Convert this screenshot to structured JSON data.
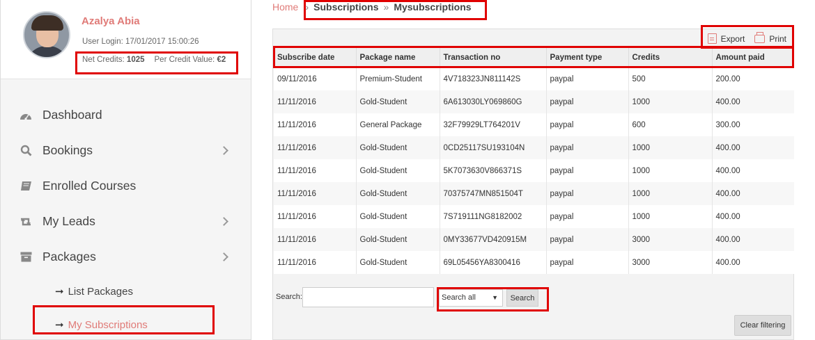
{
  "profile": {
    "name": "Azalya Abia",
    "login_label": "User Login: 17/01/2017 15:00:26",
    "net_credits_label": "Net Credits: ",
    "net_credits_value": "1025",
    "credit_value_label": "Per Credit Value: ",
    "credit_value_value": "€2"
  },
  "nav": {
    "items": [
      {
        "label": "Dashboard",
        "icon": "dashboard-icon"
      },
      {
        "label": "Bookings",
        "icon": "search-icon"
      },
      {
        "label": "Enrolled Courses",
        "icon": "book-icon"
      },
      {
        "label": "My Leads",
        "icon": "retweet-icon"
      },
      {
        "label": "Packages",
        "icon": "archive-icon"
      }
    ],
    "sub_items": [
      {
        "label": "List Packages"
      },
      {
        "label": "My Subscriptions"
      }
    ]
  },
  "breadcrumb": {
    "home": "Home",
    "sep": "»",
    "level1": "Subscriptions",
    "level2": "Mysubscriptions"
  },
  "toolbar": {
    "export": "Export",
    "print": "Print"
  },
  "table": {
    "headers": [
      "Subscribe date",
      "Package name",
      "Transaction no",
      "Payment type",
      "Credits",
      "Amount paid"
    ],
    "rows": [
      [
        "09/11/2016",
        "Premium-Student",
        "4V718323JN811142S",
        "paypal",
        "500",
        "200.00"
      ],
      [
        "11/11/2016",
        "Gold-Student",
        "6A613030LY069860G",
        "paypal",
        "1000",
        "400.00"
      ],
      [
        "11/11/2016",
        "General Package",
        "32F79929LT764201V",
        "paypal",
        "600",
        "300.00"
      ],
      [
        "11/11/2016",
        "Gold-Student",
        "0CD25117SU193104N",
        "paypal",
        "1000",
        "400.00"
      ],
      [
        "11/11/2016",
        "Gold-Student",
        "5K7073630V866371S",
        "paypal",
        "1000",
        "400.00"
      ],
      [
        "11/11/2016",
        "Gold-Student",
        "70375747MN851504T",
        "paypal",
        "1000",
        "400.00"
      ],
      [
        "11/11/2016",
        "Gold-Student",
        "7S719111NG8182002",
        "paypal",
        "1000",
        "400.00"
      ],
      [
        "11/11/2016",
        "Gold-Student",
        "0MY33677VD420915M",
        "paypal",
        "3000",
        "400.00"
      ],
      [
        "11/11/2016",
        "Gold-Student",
        "69L05456YA8300416",
        "paypal",
        "3000",
        "400.00"
      ]
    ]
  },
  "search": {
    "label": "Search:",
    "select_value": "Search all",
    "button": "Search",
    "clear": "Clear filtering"
  },
  "colors": {
    "accent": "#e07b78",
    "highlight": "#e00000"
  }
}
